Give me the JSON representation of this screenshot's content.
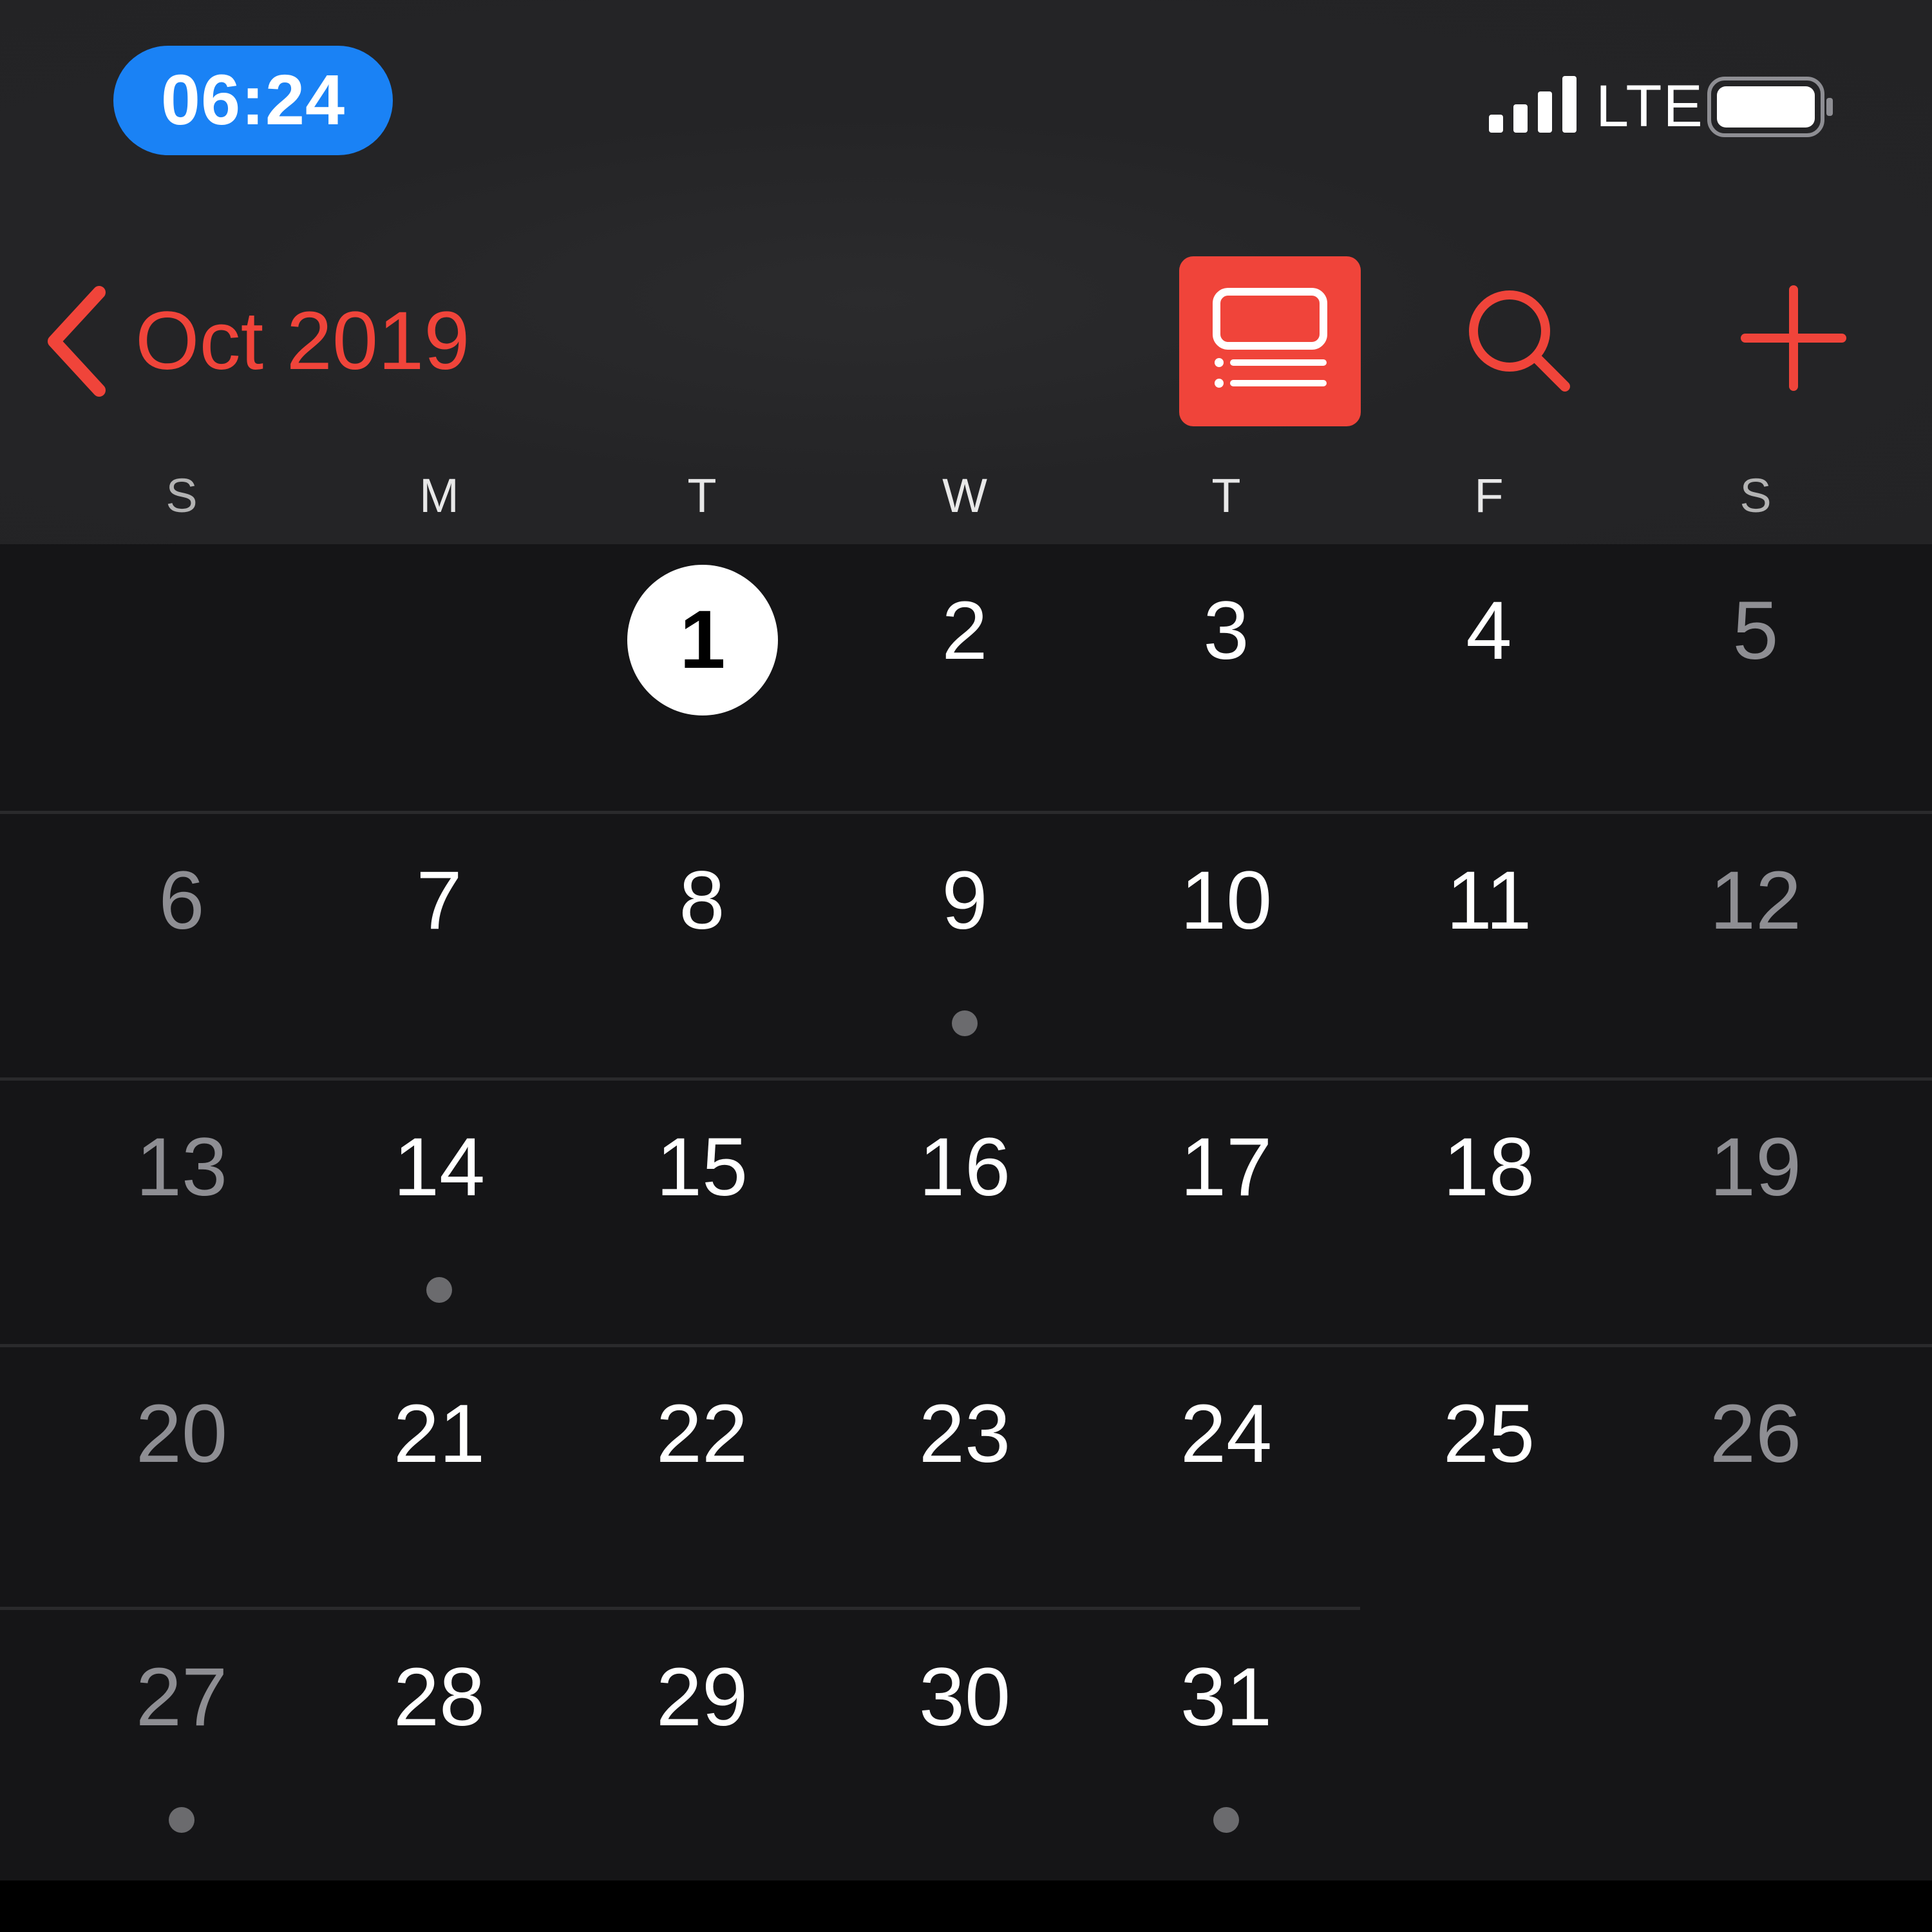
{
  "status_bar": {
    "time": "06:24",
    "network": "LTE",
    "signal_icon": "cellular-signal-icon",
    "battery_icon": "battery-icon"
  },
  "nav": {
    "month_label": "Oct 2019",
    "back_icon": "chevron-left-icon",
    "list_view_icon": "list-view-icon",
    "search_icon": "search-icon",
    "add_icon": "plus-icon"
  },
  "colors": {
    "accent": "#f0443a",
    "time_pill": "#1a82f5",
    "background": "#151517",
    "header": "#232325",
    "event_dot": "#6b6b6e"
  },
  "weekdays": [
    "S",
    "M",
    "T",
    "W",
    "T",
    "F",
    "S"
  ],
  "today": 1,
  "first_weekday_index": 2,
  "days_in_month": 31,
  "days_with_events": [
    9,
    14,
    27,
    31
  ]
}
